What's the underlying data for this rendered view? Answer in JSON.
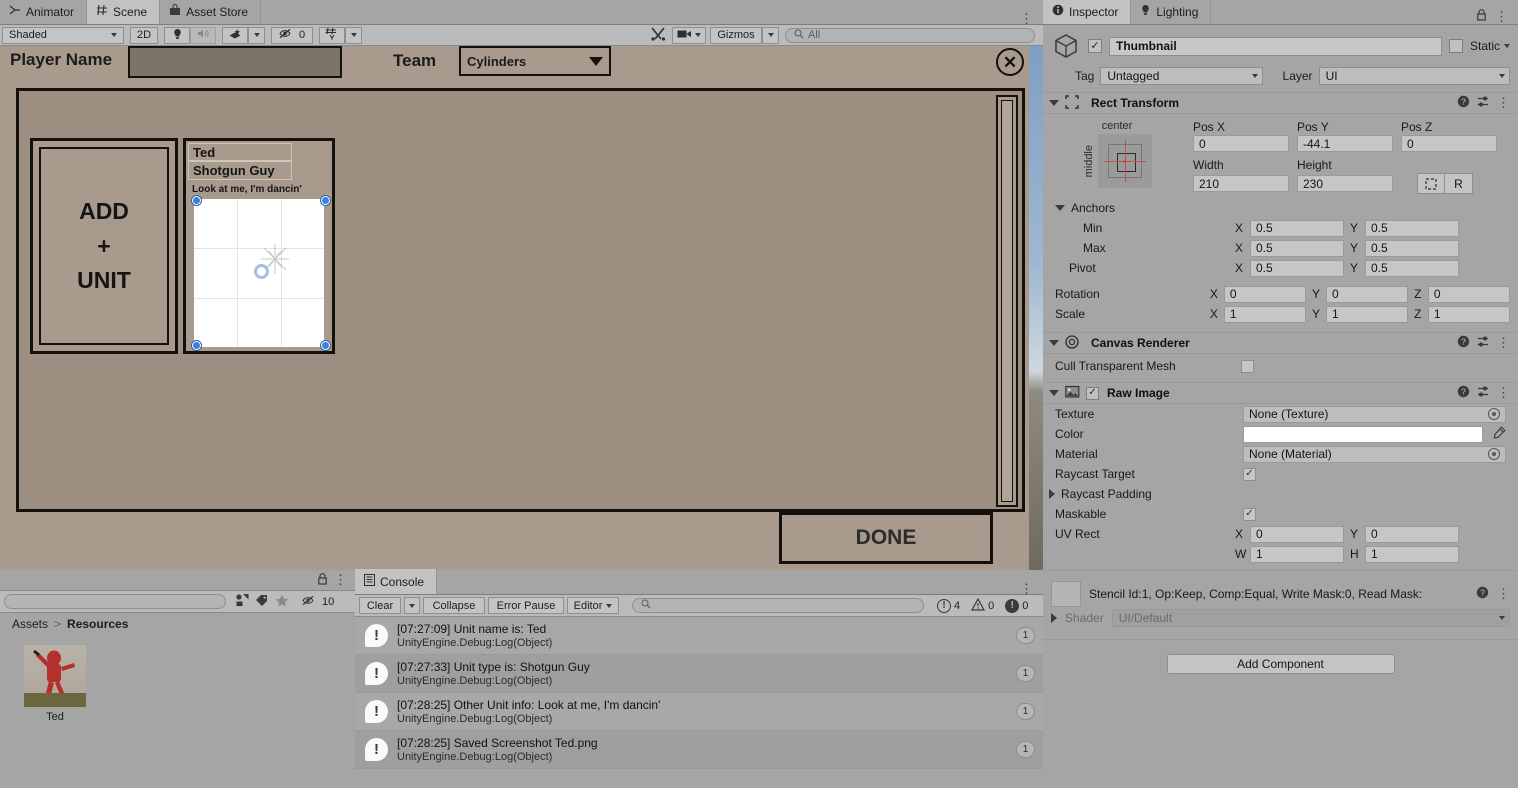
{
  "scene": {
    "tabs": [
      {
        "label": "Animator",
        "icon": "animator-icon",
        "active": false
      },
      {
        "label": "Scene",
        "icon": "grid-icon",
        "active": true
      },
      {
        "label": "Asset Store",
        "icon": "store-icon",
        "active": false
      }
    ],
    "toolbar": {
      "shading_mode": "Shaded",
      "mode_2d": "2D",
      "hidden_count": "0",
      "gizmos_label": "Gizmos",
      "search_placeholder": "All"
    },
    "game_ui": {
      "player_name_label": "Player Name",
      "player_name_value": "",
      "team_label": "Team",
      "team_value": "Cylinders",
      "close_label": "✕",
      "add_unit_line1": "ADD",
      "add_unit_line2": "+",
      "add_unit_line3": "UNIT",
      "unit_card": {
        "name": "Ted",
        "type": "Shotgun Guy",
        "info": "Look at me, I'm dancin'"
      },
      "done_label": "DONE"
    }
  },
  "project": {
    "search_value": "",
    "hidden_count": "10",
    "breadcrumb": [
      "Assets",
      "Resources"
    ],
    "assets": [
      {
        "name": "Ted"
      }
    ]
  },
  "console": {
    "tab_label": "Console",
    "buttons": {
      "clear": "Clear",
      "collapse": "Collapse",
      "error_pause": "Error Pause",
      "editor": "Editor"
    },
    "search_value": "",
    "counts": {
      "errors": "4",
      "warnings": "0",
      "infos": "0"
    },
    "logs": [
      {
        "message": "[07:27:09] Unit name is: Ted",
        "source": "UnityEngine.Debug:Log(Object)",
        "count": "1"
      },
      {
        "message": "[07:27:33] Unit type is: Shotgun Guy",
        "source": "UnityEngine.Debug:Log(Object)",
        "count": "1"
      },
      {
        "message": "[07:28:25] Other Unit info: Look at me, I'm dancin'",
        "source": "UnityEngine.Debug:Log(Object)",
        "count": "1"
      },
      {
        "message": "[07:28:25] Saved Screenshot Ted.png",
        "source": "UnityEngine.Debug:Log(Object)",
        "count": "1"
      }
    ]
  },
  "inspector": {
    "tabs": [
      {
        "label": "Inspector",
        "active": true
      },
      {
        "label": "Lighting",
        "active": false
      }
    ],
    "game_object": {
      "name": "Thumbnail",
      "enabled": true,
      "static_label": "Static",
      "tag_label": "Tag",
      "tag_value": "Untagged",
      "layer_label": "Layer",
      "layer_value": "UI"
    },
    "rect_transform": {
      "title": "Rect Transform",
      "anchor_preset_top": "center",
      "anchor_preset_left": "middle",
      "pos_x_label": "Pos X",
      "pos_x": "0",
      "pos_y_label": "Pos Y",
      "pos_y": "-44.1",
      "pos_z_label": "Pos Z",
      "pos_z": "0",
      "width_label": "Width",
      "width": "210",
      "height_label": "Height",
      "height": "230",
      "blueprint_label": "",
      "raw_label": "R",
      "anchors_label": "Anchors",
      "min_label": "Min",
      "min_x": "0.5",
      "min_y": "0.5",
      "max_label": "Max",
      "max_x": "0.5",
      "max_y": "0.5",
      "pivot_label": "Pivot",
      "pivot_x": "0.5",
      "pivot_y": "0.5",
      "rotation_label": "Rotation",
      "rot_x": "0",
      "rot_y": "0",
      "rot_z": "0",
      "scale_label": "Scale",
      "scale_x": "1",
      "scale_y": "1",
      "scale_z": "1"
    },
    "canvas_renderer": {
      "title": "Canvas Renderer",
      "cull_label": "Cull Transparent Mesh",
      "cull_checked": false
    },
    "raw_image": {
      "title": "Raw Image",
      "texture_label": "Texture",
      "texture_value": "None (Texture)",
      "color_label": "Color",
      "color_value": "#FFFFFF",
      "material_label": "Material",
      "material_value": "None (Material)",
      "raycast_target_label": "Raycast Target",
      "raycast_padding_label": "Raycast Padding",
      "maskable_label": "Maskable",
      "uv_rect_label": "UV Rect",
      "uv_x": "0",
      "uv_y": "0",
      "uv_w": "1",
      "uv_h": "1"
    },
    "material": {
      "title": "Stencil Id:1, Op:Keep, Comp:Equal, Write Mask:0, Read Mask:",
      "shader_label": "Shader",
      "shader_value": "UI/Default"
    },
    "add_component_label": "Add Component"
  }
}
